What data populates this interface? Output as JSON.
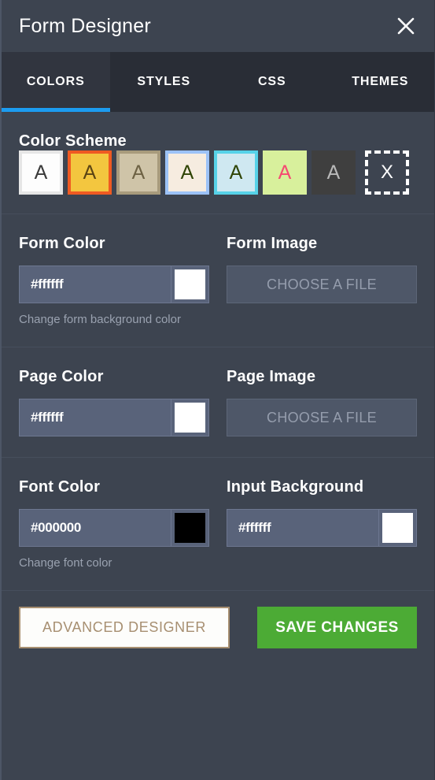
{
  "header": {
    "title": "Form Designer",
    "close_icon": "close-icon"
  },
  "tabs": [
    {
      "label": "COLORS",
      "active": true
    },
    {
      "label": "STYLES",
      "active": false
    },
    {
      "label": "CSS",
      "active": false
    },
    {
      "label": "THEMES",
      "active": false
    }
  ],
  "color_scheme": {
    "label": "Color Scheme",
    "swatches": [
      {
        "name": "scheme-white",
        "letter": "A",
        "bg": "#fdfdfd",
        "border": "#e6e6e6",
        "letter_color": "#3b3b3b"
      },
      {
        "name": "scheme-orange",
        "letter": "A",
        "bg": "#f3c63f",
        "border": "#ef5a22",
        "letter_color": "#5b4414"
      },
      {
        "name": "scheme-tan",
        "letter": "A",
        "bg": "#cfc4a8",
        "border": "#a89b7c",
        "letter_color": "#6e6244"
      },
      {
        "name": "scheme-cream",
        "letter": "A",
        "bg": "#f6ece0",
        "border": "#9cc2f7",
        "letter_color": "#2f4405"
      },
      {
        "name": "scheme-cyan",
        "letter": "A",
        "bg": "#cfe8f1",
        "border": "#57d2e8",
        "letter_color": "#2f4405"
      },
      {
        "name": "scheme-green",
        "letter": "A",
        "bg": "#d8f09c",
        "border": "#d8f09c",
        "letter_color": "#f54a72"
      },
      {
        "name": "scheme-dark",
        "letter": "A",
        "bg": "#3f3f3f",
        "border": "#3f3f3f",
        "letter_color": "#b9b9b9"
      }
    ],
    "clear_swatch": {
      "name": "scheme-none",
      "letter": "X"
    }
  },
  "fields": {
    "form_color": {
      "label": "Form Color",
      "value": "#ffffff",
      "placeholder": "#ffffff",
      "swatch_color": "#ffffff",
      "hint": "Change form background color"
    },
    "form_image": {
      "label": "Form Image",
      "button_label": "CHOOSE A FILE"
    },
    "page_color": {
      "label": "Page Color",
      "value": "#ffffff",
      "placeholder": "#ffffff",
      "swatch_color": "#ffffff",
      "hint": ""
    },
    "page_image": {
      "label": "Page Image",
      "button_label": "CHOOSE A FILE"
    },
    "font_color": {
      "label": "Font Color",
      "value": "#000000",
      "placeholder": "#000000",
      "swatch_color": "#000000",
      "hint": "Change font color"
    },
    "input_background": {
      "label": "Input Background",
      "value": "#ffffff",
      "placeholder": "#ffffff",
      "swatch_color": "#ffffff",
      "hint": ""
    }
  },
  "footer": {
    "advanced_label": "ADVANCED DESIGNER",
    "save_label": "SAVE CHANGES"
  },
  "colors": {
    "panel_bg": "#3d4450",
    "tabbar_bg": "#292d36",
    "active_tab_bg": "#31353f",
    "accent_blue": "#1c9cf0",
    "save_green": "#4cab35",
    "advanced_tan": "#a78f71"
  }
}
